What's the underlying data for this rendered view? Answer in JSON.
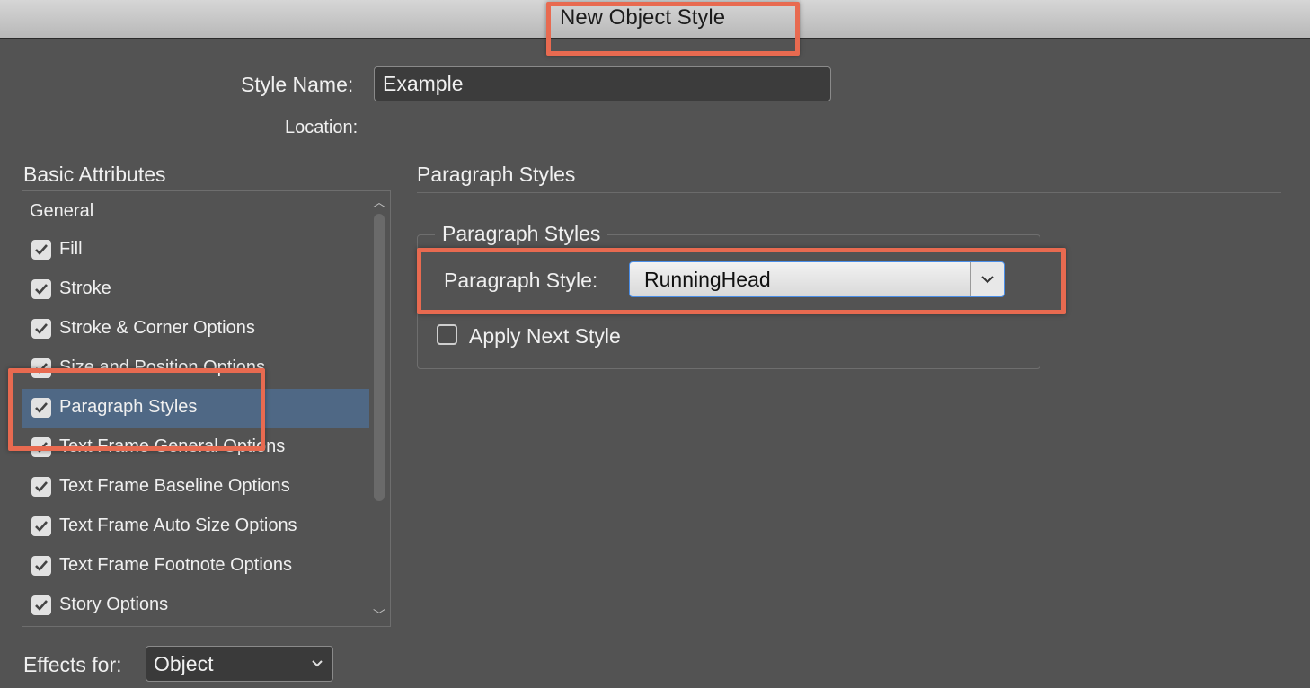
{
  "window": {
    "title": "New Object Style"
  },
  "style_name": {
    "label": "Style Name:",
    "value": "Example"
  },
  "location": {
    "label": "Location:"
  },
  "basic_attributes": {
    "heading": "Basic Attributes",
    "general_label": "General",
    "items": [
      {
        "label": "Fill",
        "checked": true
      },
      {
        "label": "Stroke",
        "checked": true
      },
      {
        "label": "Stroke & Corner Options",
        "checked": true
      },
      {
        "label": "Size and Position Options",
        "checked": true
      },
      {
        "label": "Paragraph Styles",
        "checked": true,
        "selected": true
      },
      {
        "label": "Text Frame General Options",
        "checked": true
      },
      {
        "label": "Text Frame Baseline Options",
        "checked": true
      },
      {
        "label": "Text Frame Auto Size Options",
        "checked": true
      },
      {
        "label": "Text Frame Footnote Options",
        "checked": true
      },
      {
        "label": "Story Options",
        "checked": true
      }
    ]
  },
  "panel": {
    "title": "Paragraph Styles",
    "group_title": "Paragraph Styles",
    "paragraph_style_label": "Paragraph Style:",
    "paragraph_style_value": "RunningHead",
    "apply_next_label": "Apply Next Style",
    "apply_next_checked": false
  },
  "effects": {
    "label": "Effects for:",
    "value": "Object"
  },
  "colors": {
    "background": "#535353",
    "selection": "#4f6885",
    "highlight": "#e86a50",
    "focus": "#4a8ee8"
  }
}
